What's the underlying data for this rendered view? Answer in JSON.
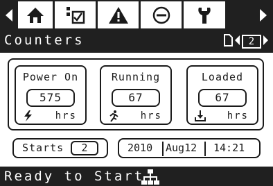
{
  "toolbar": {
    "items": [
      "left-arrow-icon",
      "home-icon",
      "checklist-icon",
      "warning-icon",
      "stop-icon",
      "service-wrench-icon",
      "right-arrow-icon"
    ],
    "selected": "home-icon"
  },
  "screen": {
    "title": "Counters",
    "page_number": "2"
  },
  "counters": [
    {
      "label": "Power On",
      "value": "575",
      "unit": "hrs",
      "icon": "lightning-icon"
    },
    {
      "label": "Running",
      "value": "67",
      "unit": "hrs",
      "icon": "running-motor-icon"
    },
    {
      "label": "Loaded",
      "value": "67",
      "unit": "hrs",
      "icon": "load-icon"
    }
  ],
  "starts": {
    "label": "Starts",
    "value": "2"
  },
  "datetime": {
    "year": "2010",
    "date": "Aug12",
    "time": "14:21"
  },
  "status": {
    "text": "Ready to Start",
    "icon": "network-icon"
  },
  "colors": {
    "dark": "#202020",
    "light": "#ffffff",
    "ink": "#1a1a1a"
  }
}
